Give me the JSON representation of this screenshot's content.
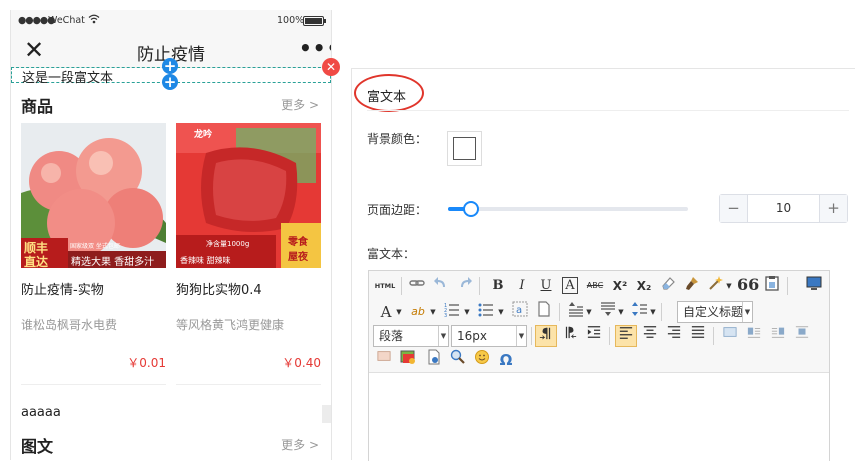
{
  "status_bar": {
    "signal": "●●●●●",
    "carrier": "WeChat",
    "battery": "100%"
  },
  "nav": {
    "close_glyph": "✕",
    "title": "防止疫情",
    "more_glyph": "•••"
  },
  "rich_text_block": {
    "text": "这是一段富文本",
    "plus_glyph": "+",
    "delete_glyph": "✕"
  },
  "goods_section": {
    "title": "商品",
    "more": "更多 >"
  },
  "products": [
    {
      "name": "防止疫情-实物",
      "desc": "谁松岛枫哥水电费",
      "price": "￥0.01",
      "badge_top": "顺丰",
      "badge_bottom": "直达",
      "banner_small": "国家级双 坐式包邮",
      "banner": "精选大果 香甜多汁"
    },
    {
      "name": "狗狗比实物0.4",
      "desc": "等风格黄飞鸿更健康",
      "price": "￥0.40",
      "brand_tag": "龙吟",
      "weight_tag": "净含量1000g",
      "flavor_tag": "香辣味 甜辣味",
      "side_tag_top": "零食",
      "side_tag_bottom": "屋夜"
    }
  ],
  "text_item": "aaaaa",
  "article_section": {
    "title": "图文",
    "more": "更多 >"
  },
  "panel": {
    "title": "富文本",
    "bg_color_label": "背景颜色：",
    "page_margin_label": "页面边距：",
    "page_margin_value": "10",
    "page_margin_fraction": 0.1,
    "stepper_minus": "−",
    "stepper_plus": "+",
    "rich_text_label": "富文本：",
    "colors": {
      "accent": "#1989fa",
      "highlight_ring": "#e0352b",
      "price": "#e53935"
    }
  },
  "toolbar": {
    "row1": [
      "HTML",
      "link-icon",
      "undo-icon",
      "redo-icon",
      "B",
      "I",
      "U",
      "A",
      "ABC",
      "X²",
      "X₂",
      "eraser-icon",
      "brush-icon",
      "magic-icon",
      "66",
      "paste-icon",
      "fullscreen-icon"
    ],
    "row2": [
      "A",
      "ab",
      "ordered-list",
      "unordered-list",
      "a",
      "page-icon",
      "line-height",
      "paragraph-spacing",
      "indent",
      "custom_title"
    ],
    "custom_title": "自定义标题",
    "paragraph_select": "段落",
    "font_size_select": "16px",
    "row4": [
      "image-icon",
      "gallery-icon",
      "video-icon",
      "search-replace-icon",
      "emotion-icon",
      "Ω"
    ],
    "text": {
      "html": "HTML",
      "bold": "B",
      "italic": "I",
      "underline": "U",
      "font_border": "A",
      "strike": "ABC",
      "sup": "X²",
      "sub": "X₂",
      "quote": "66",
      "forecolor": "A",
      "backcolor": "ab",
      "omega": "Ω"
    }
  }
}
